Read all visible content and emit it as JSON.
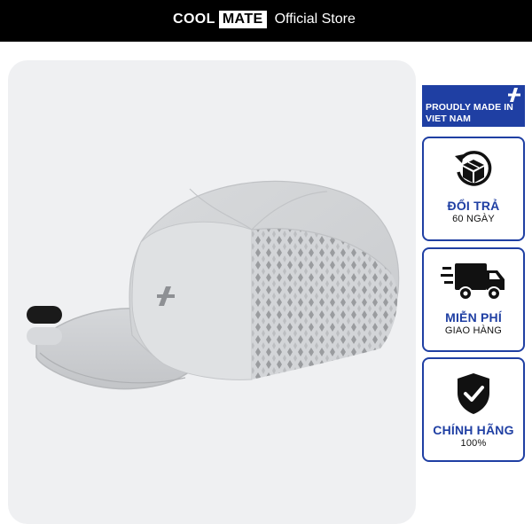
{
  "header": {
    "brand_left": "COOL",
    "brand_right": "MATE",
    "store_label": "Official Store"
  },
  "colors": {
    "header_bg": "#000000",
    "accent_blue": "#1f3fa3",
    "card_bg": "#eff0f2"
  },
  "product": {
    "swatches": [
      "black",
      "light-gray"
    ]
  },
  "badges": {
    "made_in": {
      "label": "PROUDLY MADE IN VIET NAM"
    },
    "returns": {
      "icon": "return-box-icon",
      "title": "ĐỔI TRẢ",
      "subtitle": "60 NGÀY"
    },
    "shipping": {
      "icon": "delivery-truck-icon",
      "title": "MIỄN PHÍ",
      "subtitle": "GIAO HÀNG"
    },
    "authentic": {
      "icon": "shield-check-icon",
      "title": "CHÍNH HÃNG",
      "subtitle": "100%"
    }
  }
}
